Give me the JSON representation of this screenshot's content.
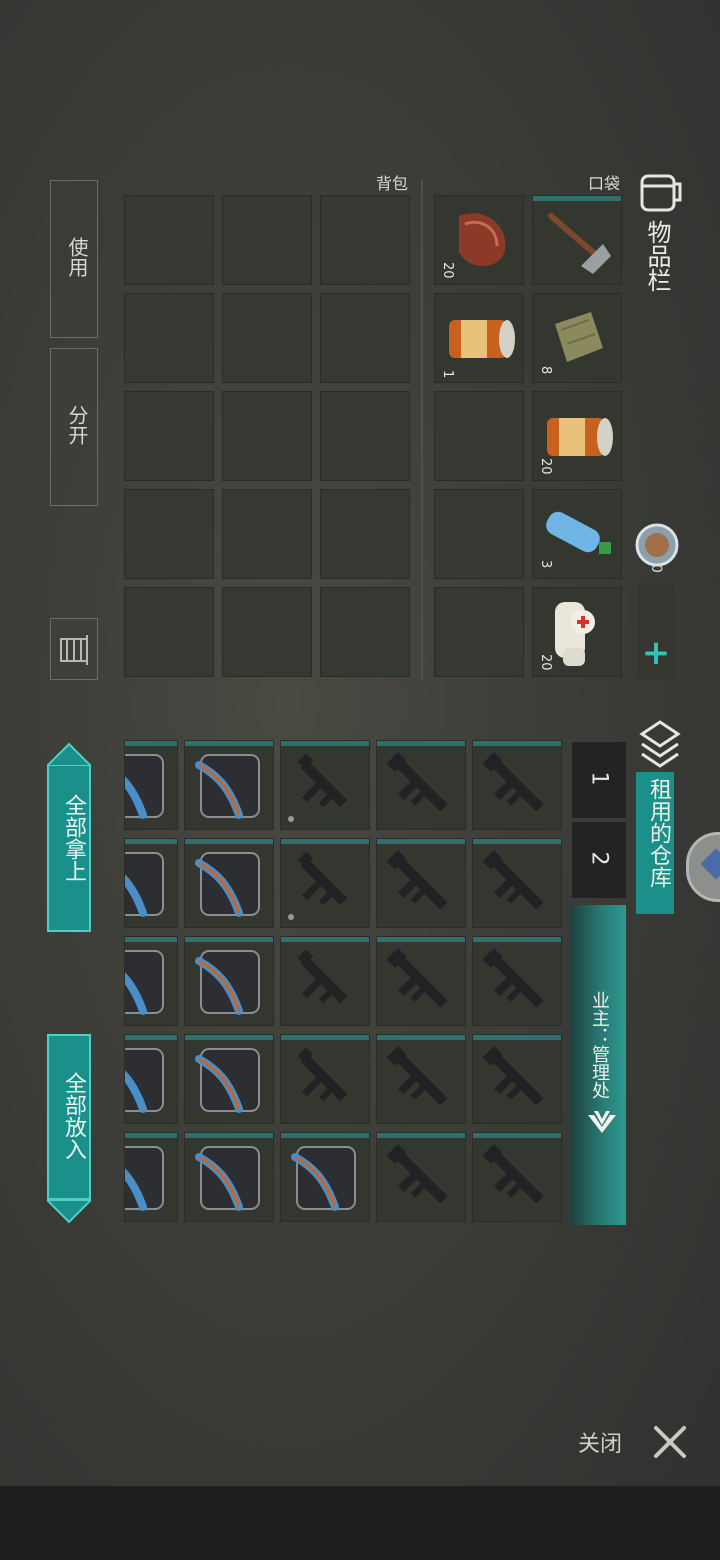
{
  "inventory": {
    "title": "物品栏",
    "pocket_label": "口袋",
    "backpack_label": "背包",
    "coin_count": "0",
    "add_symbol": "+",
    "pocket_items": [
      {
        "name": "pickaxe",
        "count": ""
      },
      {
        "name": "cloth",
        "count": "8"
      },
      {
        "name": "canned-food",
        "count": "20"
      },
      {
        "name": "water-bottle",
        "count": "3"
      },
      {
        "name": "bandage",
        "count": "20"
      }
    ],
    "pocket_items_col2": [
      {
        "name": "raw-meat",
        "count": "20"
      },
      {
        "name": "canned-food",
        "count": "1"
      }
    ]
  },
  "actions": {
    "use_label": "使用",
    "split_label": "分开",
    "take_all_label": "全部拿上",
    "put_all_label": "全部放入"
  },
  "storage": {
    "title": "租用的仓库",
    "tab1": "1",
    "tab2": "2",
    "owner_text": "业主：管理处"
  },
  "footer": {
    "close_label": "关闭"
  },
  "colors": {
    "teal": "#1b8f8a",
    "teal_border": "#4fd0c6"
  }
}
